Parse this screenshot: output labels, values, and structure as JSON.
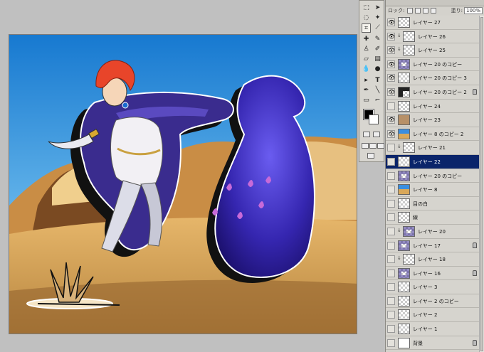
{
  "layers_panel": {
    "lock_label": "ロック:",
    "opacity_label": "塗り:",
    "opacity_value": "100%",
    "layers": [
      {
        "name": "レイヤー 27",
        "visible": true,
        "clip": false,
        "thumb": "transparent",
        "locked": false,
        "selected": false
      },
      {
        "name": "レイヤー 26",
        "visible": true,
        "clip": true,
        "thumb": "transparent",
        "locked": false,
        "selected": false
      },
      {
        "name": "レイヤー 25",
        "visible": true,
        "clip": true,
        "thumb": "transparent",
        "locked": false,
        "selected": false
      },
      {
        "name": "レイヤー 20 のコピー",
        "visible": true,
        "clip": false,
        "thumb": "figure",
        "locked": false,
        "selected": false
      },
      {
        "name": "レイヤー 20 のコピー 3",
        "visible": true,
        "clip": false,
        "thumb": "transparent",
        "locked": false,
        "selected": false
      },
      {
        "name": "レイヤー 20 のコピー 2",
        "visible": true,
        "clip": false,
        "thumb": "blob",
        "locked": true,
        "selected": false
      },
      {
        "name": "レイヤー 24",
        "visible": false,
        "clip": false,
        "thumb": "transparent",
        "locked": false,
        "selected": false
      },
      {
        "name": "レイヤー 23",
        "visible": true,
        "clip": false,
        "thumb": "sand",
        "locked": false,
        "selected": false
      },
      {
        "name": "レイヤー 8 のコピー 2",
        "visible": true,
        "clip": false,
        "thumb": "scene",
        "locked": false,
        "selected": false
      },
      {
        "name": "レイヤー 21",
        "visible": false,
        "clip": true,
        "thumb": "transparent",
        "locked": false,
        "selected": false
      },
      {
        "name": "レイヤー 22",
        "visible": false,
        "clip": false,
        "thumb": "transparent",
        "locked": false,
        "selected": true
      },
      {
        "name": "レイヤー 20 のコピー",
        "visible": false,
        "clip": false,
        "thumb": "figure",
        "locked": false,
        "selected": false
      },
      {
        "name": "レイヤー 8",
        "visible": false,
        "clip": false,
        "thumb": "scene",
        "locked": false,
        "selected": false
      },
      {
        "name": "目の白",
        "visible": false,
        "clip": false,
        "thumb": "transparent",
        "locked": false,
        "selected": false
      },
      {
        "name": "線",
        "visible": false,
        "clip": false,
        "thumb": "transparent",
        "locked": false,
        "selected": false
      },
      {
        "name": "レイヤー 20",
        "visible": false,
        "clip": true,
        "thumb": "figure",
        "locked": false,
        "selected": false
      },
      {
        "name": "レイヤー 17",
        "visible": false,
        "clip": false,
        "thumb": "figure",
        "locked": true,
        "selected": false
      },
      {
        "name": "レイヤー 18",
        "visible": false,
        "clip": true,
        "thumb": "transparent",
        "locked": false,
        "selected": false
      },
      {
        "name": "レイヤー 16",
        "visible": false,
        "clip": false,
        "thumb": "figure",
        "locked": true,
        "selected": false
      },
      {
        "name": "レイヤー 3",
        "visible": false,
        "clip": false,
        "thumb": "transparent",
        "locked": false,
        "selected": false
      },
      {
        "name": "レイヤー 2 のコピー",
        "visible": false,
        "clip": false,
        "thumb": "transparent",
        "locked": false,
        "selected": false
      },
      {
        "name": "レイヤー 2",
        "visible": false,
        "clip": false,
        "thumb": "transparent",
        "locked": false,
        "selected": false
      },
      {
        "name": "レイヤー 1",
        "visible": false,
        "clip": false,
        "thumb": "transparent",
        "locked": false,
        "selected": false
      },
      {
        "name": "背景",
        "visible": false,
        "clip": false,
        "thumb": "white",
        "locked": true,
        "selected": false
      }
    ]
  },
  "tools": {
    "icons": [
      "marquee-icon",
      "move-icon",
      "lasso-icon",
      "magic-wand-icon",
      "crop-icon",
      "slice-icon",
      "healing-icon",
      "brush-icon",
      "stamp-icon",
      "history-brush-icon",
      "eraser-icon",
      "gradient-icon",
      "blur-icon",
      "dodge-icon",
      "path-select-icon",
      "type-icon",
      "pen-icon",
      "shape-icon",
      "notes-icon",
      "eyedropper-icon",
      "hand-icon",
      "zoom-icon"
    ]
  },
  "colors": {
    "sky_top": "#1f86d8",
    "sky_bottom": "#8ec6ec",
    "sand": "#d9a85a",
    "ghost": "#3b2fb8",
    "hair": "#e8452a",
    "selected_layer": "#0a246a"
  }
}
